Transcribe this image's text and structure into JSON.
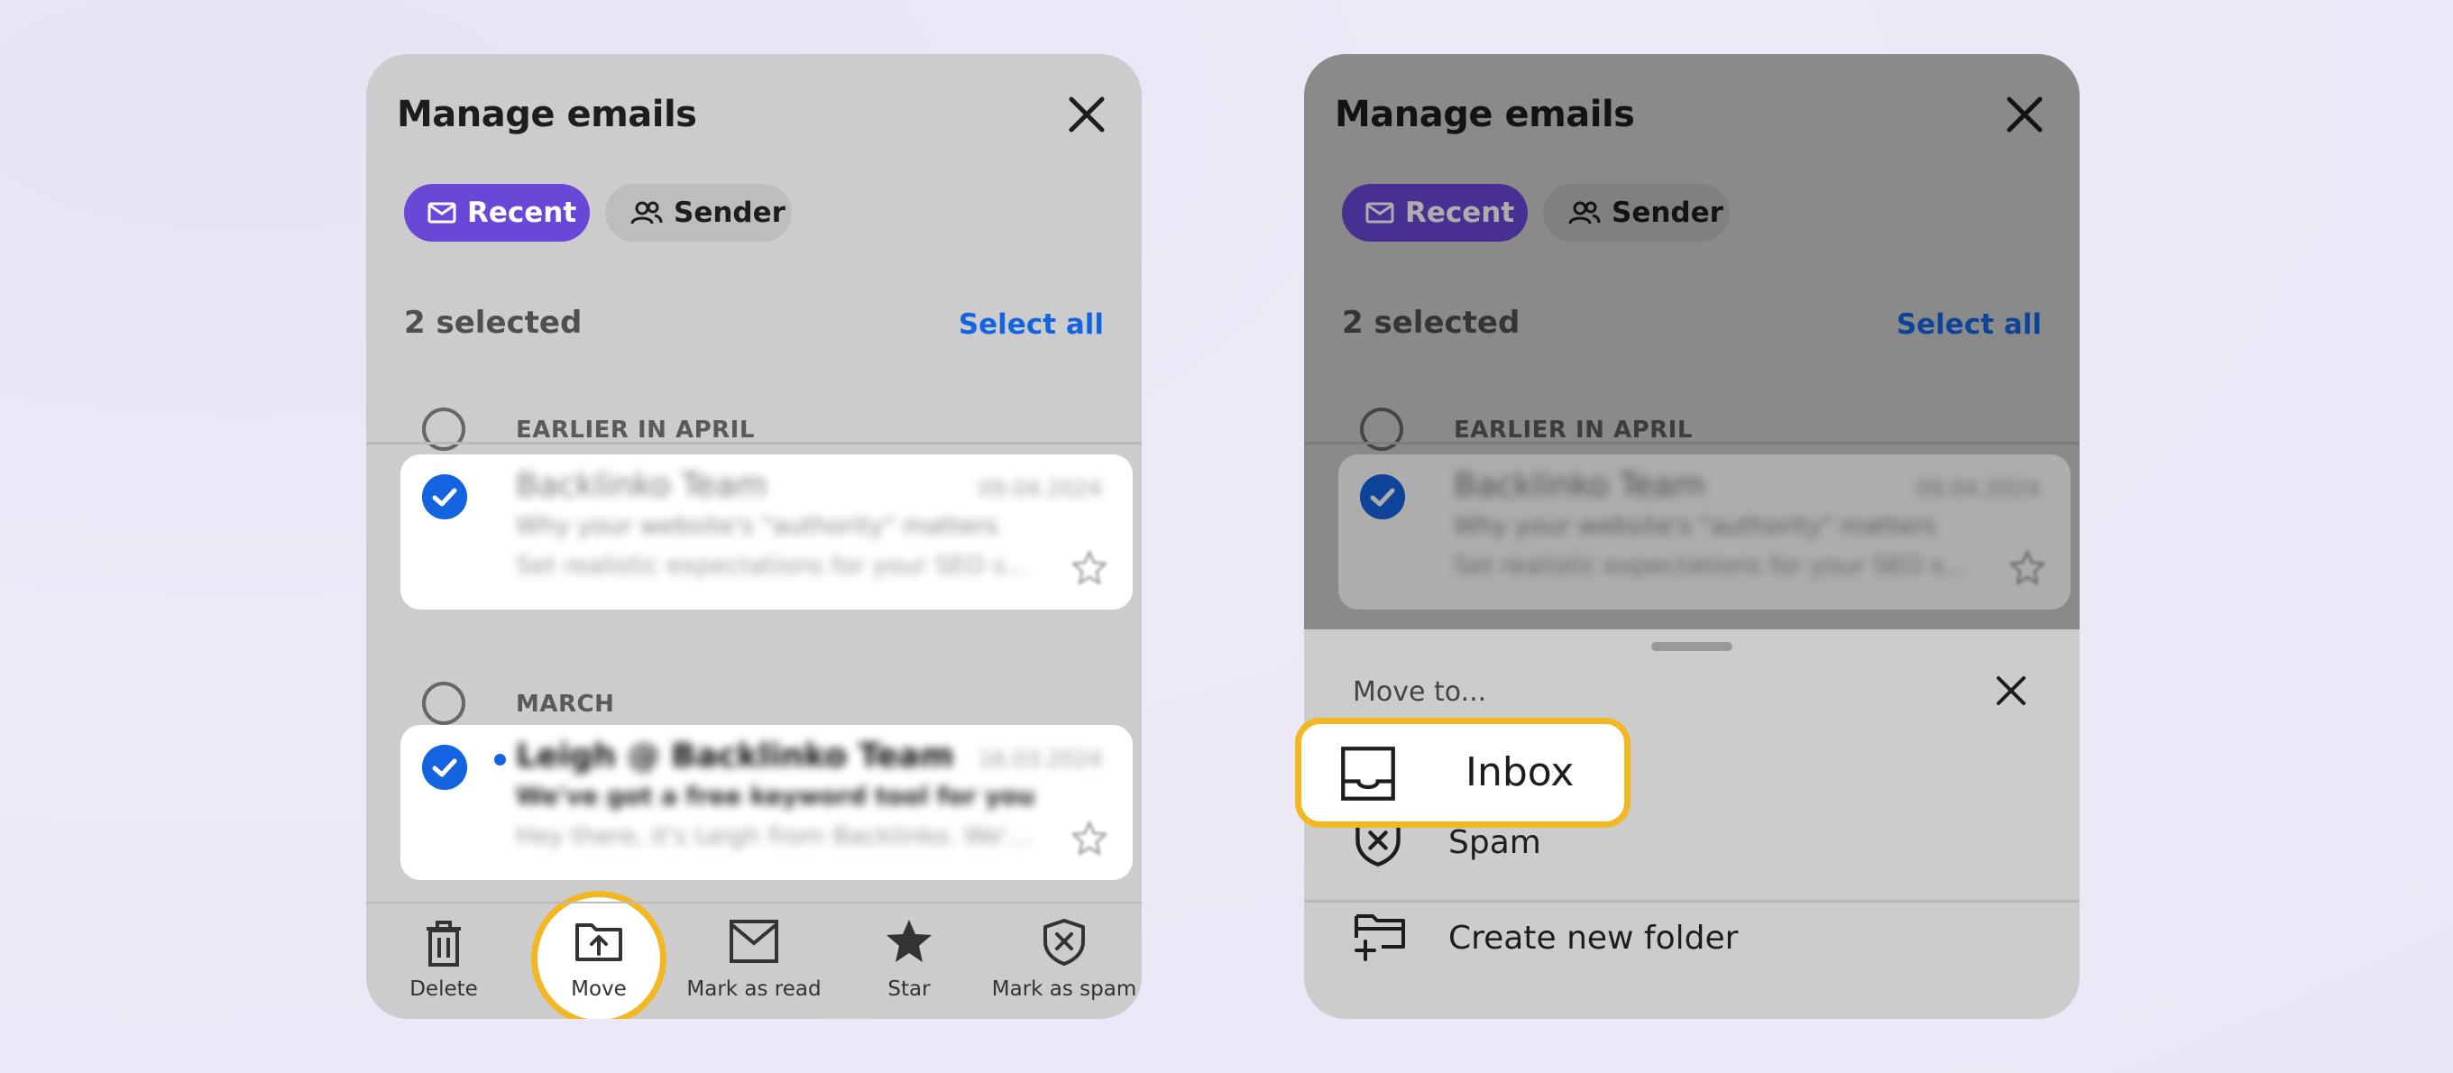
{
  "screen": {
    "title": "Manage emails",
    "tabs": [
      {
        "label": "Recent",
        "active": true
      },
      {
        "label": "Sender",
        "active": false
      }
    ],
    "selected_count": "2 selected",
    "select_all": "Select all",
    "groups": [
      {
        "label": "EARLIER IN APRIL"
      },
      {
        "label": "MARCH"
      }
    ],
    "emails": [
      {
        "sender": "Backlinko Team",
        "date": "09.04.2024",
        "subject": "Why your website's \"authority\" matters",
        "preview": "Set realistic expectations for your SEO s...",
        "checked": true,
        "unread": false
      },
      {
        "sender": "Leigh @ Backlinko Team",
        "date": "16.03.2024",
        "subject": "We've got a free keyword tool for you",
        "preview": "Hey there, it's Leigh from Backlinko. We'...",
        "checked": true,
        "unread": true
      }
    ],
    "toolbar": [
      {
        "label": "Delete",
        "icon": "trash-icon"
      },
      {
        "label": "Move",
        "icon": "folder-move-icon"
      },
      {
        "label": "Mark as read",
        "icon": "envelope-icon"
      },
      {
        "label": "Star",
        "icon": "star-icon"
      },
      {
        "label": "Mark as spam",
        "icon": "spam-shield-icon"
      }
    ]
  },
  "move_sheet": {
    "title": "Move to...",
    "options": [
      {
        "label": "Inbox",
        "icon": "inbox-tray-icon"
      },
      {
        "label": "Spam",
        "icon": "spam-shield-icon"
      },
      {
        "label": "Create new folder",
        "icon": "new-folder-icon"
      }
    ]
  },
  "colors": {
    "accent": "#6a48d7",
    "link": "#1463e0",
    "highlight": "#f4b724",
    "panel": "#cccccc"
  }
}
